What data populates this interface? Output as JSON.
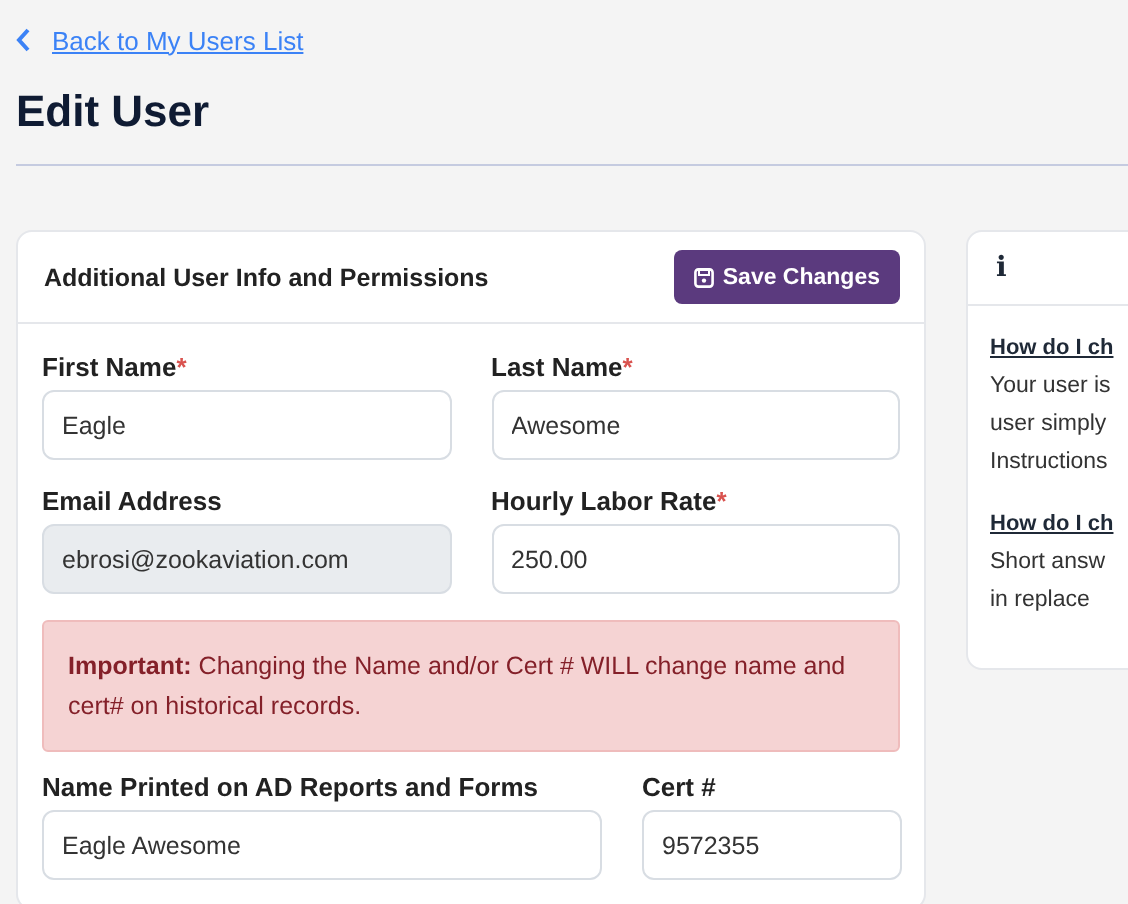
{
  "back_link": {
    "label": "Back to My Users List"
  },
  "page_title": "Edit User",
  "required_mark": "*",
  "card": {
    "title": "Additional User Info and Permissions",
    "save_button": "Save Changes",
    "rows": [
      [
        {
          "label": "First Name",
          "required": true,
          "value": "Eagle",
          "disabled": false
        },
        {
          "label": "Last Name",
          "required": true,
          "value": "Awesome",
          "disabled": false
        }
      ],
      [
        {
          "label": "Email Address",
          "required": false,
          "value": "ebrosi@zookaviation.com",
          "disabled": true
        },
        {
          "label": "Hourly Labor Rate",
          "required": true,
          "value": "250.00",
          "disabled": false
        }
      ]
    ],
    "alert": "**Important:** Changing the Name and/or Cert # WILL change name and cert# on historical records.",
    "rows_after": [
      [
        {
          "label": "Name Printed on AD Reports and Forms",
          "required": false,
          "value": "Eagle Awesome",
          "disabled": false
        },
        {
          "label": "Cert #",
          "required": false,
          "value": "9572355",
          "disabled": false
        }
      ]
    ]
  },
  "help_panel": {
    "header_icon": "i",
    "sections": [
      {
        "question": "How do I ch",
        "answer_lines": [
          "Your user is",
          "user simply",
          "Instructions"
        ]
      },
      {
        "question": "How do I ch",
        "answer_lines": [
          "Short answ",
          "in replace"
        ]
      }
    ]
  }
}
